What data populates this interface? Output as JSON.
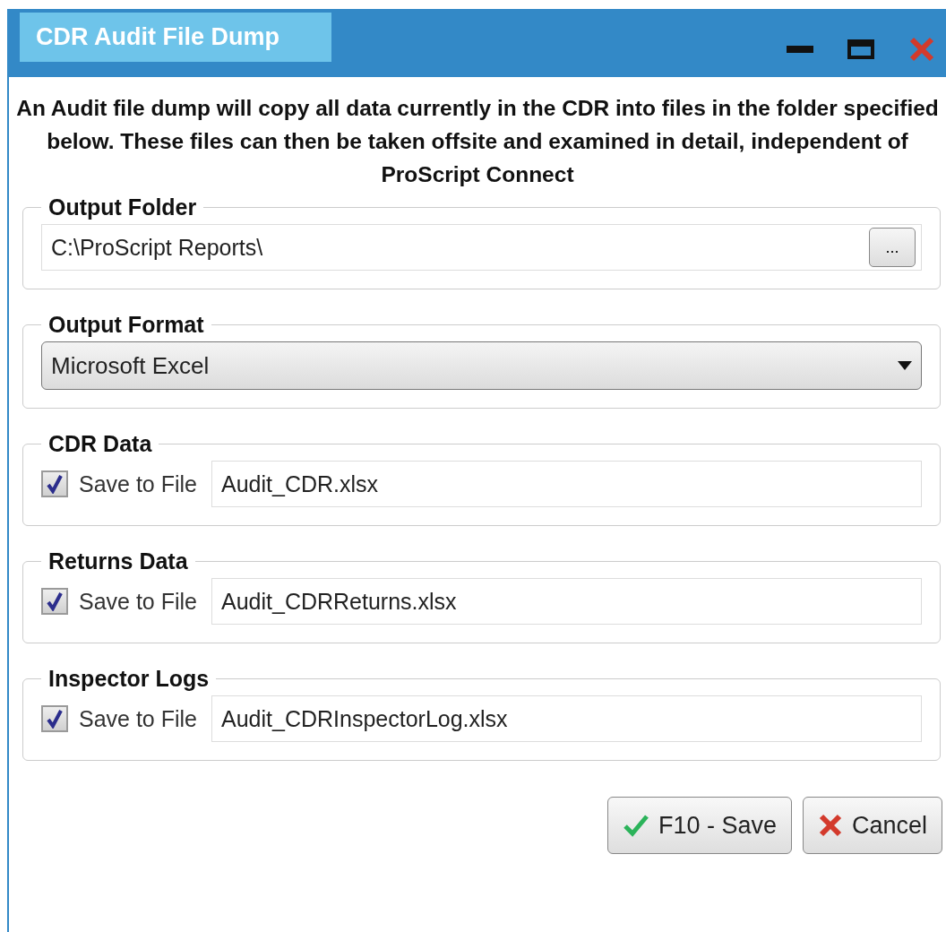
{
  "window": {
    "title": "CDR Audit File Dump"
  },
  "description": "An Audit file dump will copy all data currently in the CDR into files in the folder specified below. These files can then be taken offsite and examined in detail, independent of ProScript Connect",
  "groups": [
    {
      "kind": "folder",
      "title": "Output Folder",
      "value": "C:\\ProScript Reports\\",
      "browse_label": "..."
    },
    {
      "kind": "dropdown",
      "title": "Output Format",
      "value": "Microsoft Excel"
    },
    {
      "kind": "file",
      "title": "CDR Data",
      "checkbox_label": "Save to File",
      "checked": true,
      "value": "Audit_CDR.xlsx"
    },
    {
      "kind": "file",
      "title": "Returns Data",
      "checkbox_label": "Save to File",
      "checked": true,
      "value": "Audit_CDRReturns.xlsx"
    },
    {
      "kind": "file",
      "title": "Inspector Logs",
      "checkbox_label": "Save to File",
      "checked": true,
      "value": "Audit_CDRInspectorLog.xlsx"
    }
  ],
  "buttons": [
    {
      "kind": "save",
      "label": "F10 - Save"
    },
    {
      "kind": "cancel",
      "label": "Cancel"
    }
  ]
}
